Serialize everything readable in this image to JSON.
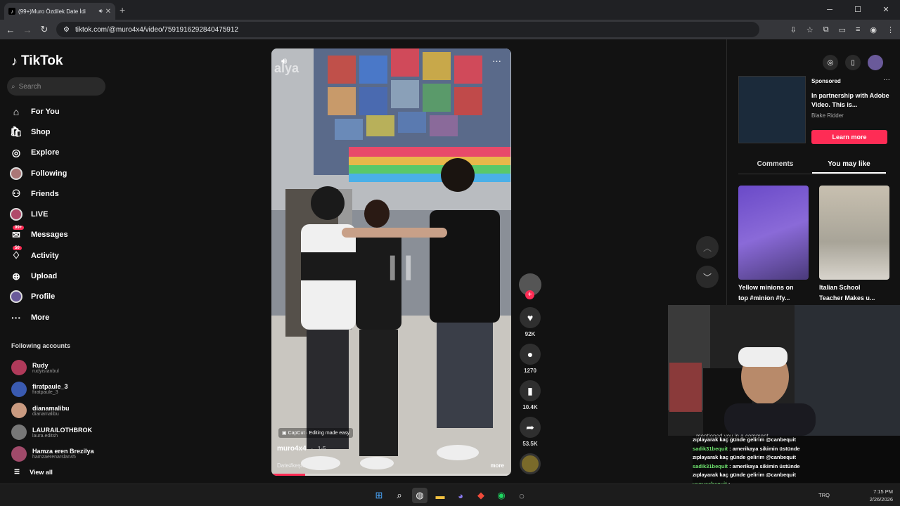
{
  "browser": {
    "tab_title": "(99+)Muro Özdilek Date İdi",
    "url": "tiktok.com/@muro4x4/video/7591916292840475912"
  },
  "tiktok": {
    "logo": "TikTok",
    "search_placeholder": "Search",
    "nav": [
      {
        "label": "For You",
        "icon": "home-icon"
      },
      {
        "label": "Shop",
        "icon": "shop-icon"
      },
      {
        "label": "Explore",
        "icon": "compass-icon"
      },
      {
        "label": "Following",
        "icon": "following-avatar"
      },
      {
        "label": "Friends",
        "icon": "friends-icon"
      },
      {
        "label": "LIVE",
        "icon": "live-avatar"
      },
      {
        "label": "Messages",
        "icon": "messages-icon",
        "badge": "99+"
      },
      {
        "label": "Activity",
        "icon": "activity-icon",
        "badge": "50"
      },
      {
        "label": "Upload",
        "icon": "upload-icon"
      },
      {
        "label": "Profile",
        "icon": "profile-avatar"
      },
      {
        "label": "More",
        "icon": "more-icon"
      }
    ],
    "following_title": "Following accounts",
    "following": [
      {
        "name": "Rudy",
        "handle": "rudyistanbul",
        "color": "#b03a5a"
      },
      {
        "name": "firatpaule_3",
        "handle": "firatpaule_3",
        "color": "#3a5ab0"
      },
      {
        "name": "dianamalibu",
        "handle": "dianamalibu",
        "color": "#c99a80"
      },
      {
        "name": "LAURA/LOTHBROK",
        "handle": "laura.editsh",
        "color": "#777"
      },
      {
        "name": "Hamza eren Brezilya",
        "handle": "hamzaerenarslan45",
        "color": "#a04a6a"
      }
    ],
    "view_all": "View all"
  },
  "video": {
    "watermark": "alya",
    "capcut": "CapCut · Editing made easy",
    "username": "muro4x4",
    "date": "1-5",
    "description": "Date#keşfet #date ...",
    "more": "more",
    "progress": 0.14
  },
  "actions": {
    "likes": "92K",
    "comments": "1270",
    "saves": "10.4K",
    "shares": "53.5K"
  },
  "ad": {
    "sponsored": "Sponsored",
    "title": "In partnership with Adobe Video. This is...",
    "author": "Blake Ridder",
    "button": "Learn more"
  },
  "panel_tabs": [
    "Comments",
    "You may like"
  ],
  "you_may_like": [
    {
      "caption1": "Yellow minions on",
      "caption2": "top #minion #fy..."
    },
    {
      "caption1": "Italian School",
      "caption2": "Teacher Makes u..."
    }
  ],
  "chat": [
    {
      "user": "",
      "msg": "zıplayarak kaç günde gelirim @canbequit"
    },
    {
      "user": "sadik31bequit",
      "msg": ": amerikaya sikimin üstünde"
    },
    {
      "user": "",
      "msg": "zıplayarak kaç günde gelirim @canbequit"
    },
    {
      "user": "sadik31bequit",
      "msg": ": amerikaya sikimin üstünde"
    },
    {
      "user": "",
      "msg": "zıplayarak kaç günde gelirim @canbequit"
    },
    {
      "user": "yunussbequit",
      "msg": ":"
    }
  ],
  "notif": "mentioned you in a comment",
  "tray": {
    "lang": "TRQ",
    "time": "7:15 PM",
    "date": "2/26/2026"
  }
}
